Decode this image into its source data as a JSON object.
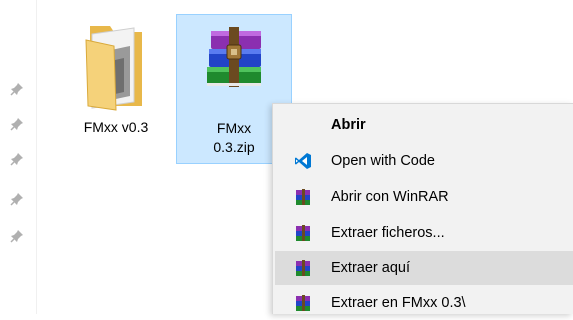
{
  "files": [
    {
      "name": "FMxx v0.3",
      "icon": "folder-icon"
    },
    {
      "name_lines": [
        "FMxx",
        "0.3.zip"
      ],
      "icon": "winrar-archive-icon"
    }
  ],
  "context_menu": {
    "items": [
      {
        "label": "Abrir",
        "icon": "none",
        "bold": true
      },
      {
        "label": "Open with Code",
        "icon": "vscode-icon"
      },
      {
        "label": "Abrir con WinRAR",
        "icon": "winrar-icon"
      },
      {
        "label": "Extraer ficheros...",
        "icon": "winrar-icon"
      },
      {
        "label": "Extraer aquí",
        "icon": "winrar-icon",
        "highlighted": true
      },
      {
        "label": "Extraer en FMxx 0.3\\",
        "icon": "winrar-icon"
      }
    ]
  },
  "colors": {
    "selection_bg": "#cce8ff",
    "selection_border": "#99d1ff",
    "menu_bg": "#f2f2f2",
    "menu_hover": "#dcdcdc",
    "vscode_blue": "#0078d4"
  }
}
